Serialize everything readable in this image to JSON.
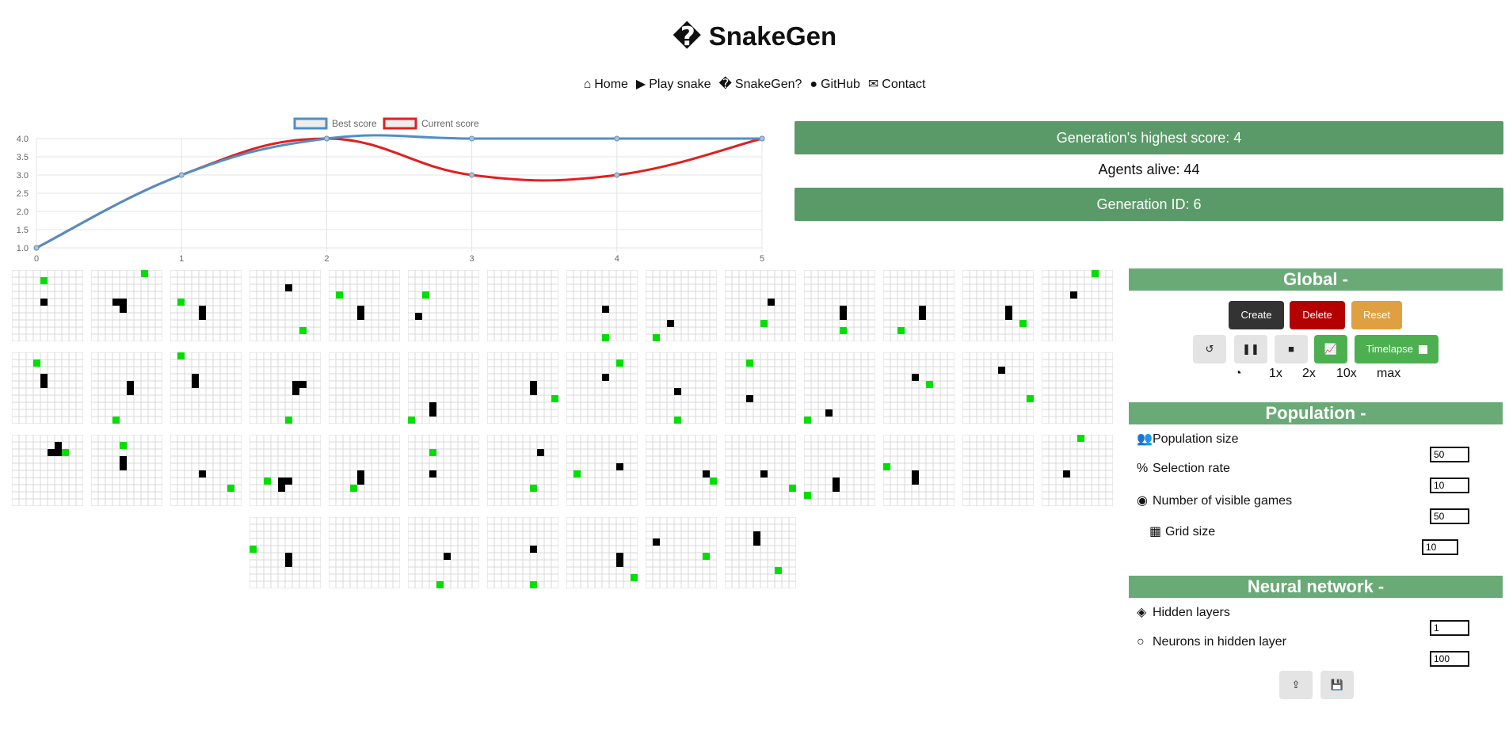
{
  "header": {
    "title": "� SnakeGen"
  },
  "nav": [
    {
      "icon": "home-icon",
      "glyph": "⌂",
      "label": "Home"
    },
    {
      "icon": "play-icon",
      "glyph": "▶",
      "label": "Play snake"
    },
    {
      "icon": "unknown-glyph-icon",
      "glyph": "�",
      "label": "SnakeGen?"
    },
    {
      "icon": "github-icon",
      "glyph": "●",
      "label": "GitHub"
    },
    {
      "icon": "envelope-icon",
      "glyph": "✉",
      "label": "Contact"
    }
  ],
  "chart_data": {
    "type": "line",
    "x": [
      0,
      1,
      2,
      3,
      4,
      5
    ],
    "series": [
      {
        "name": "Best score",
        "values": [
          1,
          3,
          4,
          4,
          4,
          4
        ],
        "color": "#4f8fc4"
      },
      {
        "name": "Current score",
        "values": [
          1,
          3,
          4,
          3,
          3,
          4
        ],
        "color": "#e02020"
      }
    ],
    "xticks": [
      "0",
      "1",
      "2",
      "3",
      "4",
      "5"
    ],
    "yticks": [
      "1.0",
      "1.5",
      "2.0",
      "2.5",
      "3.0",
      "3.5",
      "4.0"
    ],
    "ylim": [
      1,
      4
    ],
    "xlim": [
      0,
      5
    ],
    "legend": "top",
    "grid": true
  },
  "stats": {
    "highest": "Generation's highest score: 4",
    "agents": "Agents alive: 44",
    "generation": "Generation ID: 6"
  },
  "games": [
    {
      "food": [
        4,
        1
      ],
      "snake": [
        [
          4,
          4
        ]
      ]
    },
    {
      "food": [
        7,
        0
      ],
      "snake": [
        [
          3,
          4
        ],
        [
          4,
          4
        ],
        [
          4,
          5
        ]
      ]
    },
    {
      "food": [
        1,
        4
      ],
      "snake": [
        [
          4,
          5
        ],
        [
          4,
          6
        ]
      ]
    },
    {
      "food": [
        7,
        8
      ],
      "snake": [
        [
          5,
          2
        ]
      ]
    },
    {
      "food": [
        1,
        3
      ],
      "snake": [
        [
          4,
          5
        ],
        [
          4,
          6
        ]
      ]
    },
    {
      "food": [
        2,
        3
      ],
      "snake": [
        [
          1,
          6
        ]
      ]
    },
    {
      "food": null,
      "snake": []
    },
    {
      "food": [
        5,
        9
      ],
      "snake": [
        [
          5,
          5
        ]
      ]
    },
    {
      "food": [
        1,
        9
      ],
      "snake": [
        [
          3,
          7
        ]
      ]
    },
    {
      "food": [
        5,
        7
      ],
      "snake": [
        [
          6,
          4
        ]
      ]
    },
    {
      "food": [
        5,
        8
      ],
      "snake": [
        [
          5,
          5
        ],
        [
          5,
          6
        ]
      ]
    },
    {
      "food": [
        2,
        8
      ],
      "snake": [
        [
          5,
          5
        ],
        [
          5,
          6
        ]
      ]
    },
    {
      "food": [
        8,
        7
      ],
      "snake": [
        [
          6,
          5
        ],
        [
          6,
          6
        ]
      ]
    },
    {
      "food": [
        7,
        0
      ],
      "snake": [
        [
          4,
          3
        ]
      ]
    },
    {
      "food": [
        3,
        1
      ],
      "snake": [
        [
          4,
          3
        ],
        [
          4,
          4
        ]
      ]
    },
    {
      "food": [
        3,
        9
      ],
      "snake": [
        [
          5,
          4
        ],
        [
          5,
          5
        ]
      ]
    },
    {
      "food": [
        1,
        0
      ],
      "snake": [
        [
          3,
          3
        ],
        [
          3,
          4
        ]
      ]
    },
    {
      "food": [
        5,
        9
      ],
      "snake": [
        [
          6,
          4
        ],
        [
          7,
          4
        ],
        [
          6,
          5
        ]
      ]
    },
    {
      "food": null,
      "snake": []
    },
    {
      "food": [
        0,
        9
      ],
      "snake": [
        [
          3,
          7
        ],
        [
          3,
          8
        ]
      ]
    },
    {
      "food": [
        9,
        6
      ],
      "snake": [
        [
          6,
          4
        ],
        [
          6,
          5
        ]
      ]
    },
    {
      "food": [
        7,
        1
      ],
      "snake": [
        [
          5,
          3
        ]
      ]
    },
    {
      "food": [
        4,
        9
      ],
      "snake": [
        [
          4,
          5
        ]
      ]
    },
    {
      "food": [
        3,
        1
      ],
      "snake": [
        [
          3,
          6
        ]
      ]
    },
    {
      "food": [
        0,
        9
      ],
      "snake": [
        [
          3,
          8
        ]
      ]
    },
    {
      "food": [
        6,
        4
      ],
      "snake": [
        [
          4,
          3
        ]
      ]
    },
    {
      "food": [
        9,
        6
      ],
      "snake": [
        [
          5,
          2
        ]
      ]
    },
    {
      "food": null,
      "snake": []
    },
    {
      "food": [
        7,
        2
      ],
      "snake": [
        [
          6,
          1
        ],
        [
          5,
          2
        ],
        [
          6,
          2
        ]
      ]
    },
    {
      "food": [
        4,
        1
      ],
      "snake": [
        [
          4,
          3
        ],
        [
          4,
          4
        ]
      ]
    },
    {
      "food": [
        8,
        7
      ],
      "snake": [
        [
          4,
          5
        ]
      ]
    },
    {
      "food": [
        2,
        6
      ],
      "snake": [
        [
          4,
          6
        ],
        [
          5,
          6
        ],
        [
          4,
          7
        ]
      ]
    },
    {
      "food": [
        3,
        7
      ],
      "snake": [
        [
          4,
          5
        ],
        [
          4,
          6
        ]
      ]
    },
    {
      "food": [
        3,
        2
      ],
      "snake": [
        [
          3,
          5
        ]
      ]
    },
    {
      "food": [
        6,
        7
      ],
      "snake": [
        [
          7,
          2
        ]
      ]
    },
    {
      "food": [
        1,
        5
      ],
      "snake": [
        [
          7,
          4
        ]
      ]
    },
    {
      "food": [
        9,
        6
      ],
      "snake": [
        [
          8,
          5
        ]
      ]
    },
    {
      "food": [
        9,
        7
      ],
      "snake": [
        [
          5,
          5
        ]
      ]
    },
    {
      "food": [
        0,
        8
      ],
      "snake": [
        [
          4,
          6
        ],
        [
          4,
          7
        ]
      ]
    },
    {
      "food": [
        0,
        4
      ],
      "snake": [
        [
          4,
          5
        ],
        [
          4,
          6
        ]
      ]
    },
    {
      "food": null,
      "snake": []
    },
    {
      "food": [
        5,
        0
      ],
      "snake": [
        [
          3,
          5
        ]
      ]
    },
    {
      "food": [
        0,
        4
      ],
      "snake": [
        [
          5,
          5
        ],
        [
          5,
          6
        ]
      ]
    },
    {
      "food": null,
      "snake": []
    },
    {
      "food": [
        4,
        9
      ],
      "snake": [
        [
          5,
          5
        ]
      ]
    },
    {
      "food": [
        6,
        9
      ],
      "snake": [
        [
          6,
          4
        ]
      ]
    },
    {
      "food": [
        9,
        8
      ],
      "snake": [
        [
          7,
          5
        ],
        [
          7,
          6
        ]
      ]
    },
    {
      "food": [
        8,
        5
      ],
      "snake": [
        [
          1,
          3
        ]
      ]
    },
    {
      "food": [
        7,
        7
      ],
      "snake": [
        [
          4,
          2
        ],
        [
          4,
          3
        ]
      ]
    }
  ],
  "global": {
    "heading": "Global -",
    "create": "Create",
    "delete": "Delete",
    "reset": "Reset",
    "timelapse": "Timelapse",
    "speeds": [
      "1x",
      "2x",
      "10x",
      "max"
    ]
  },
  "population": {
    "heading": "Population -",
    "size_label": "Population size",
    "size_value": "50",
    "selection_label": "Selection rate",
    "selection_value": "10",
    "visible_label": "Number of visible games",
    "visible_value": "50",
    "grid_label": "Grid size",
    "grid_value": "10"
  },
  "neural": {
    "heading": "Neural network -",
    "hidden_label": "Hidden layers",
    "hidden_value": "1",
    "neurons_label": "Neurons in hidden layer",
    "neurons_value": "100"
  }
}
